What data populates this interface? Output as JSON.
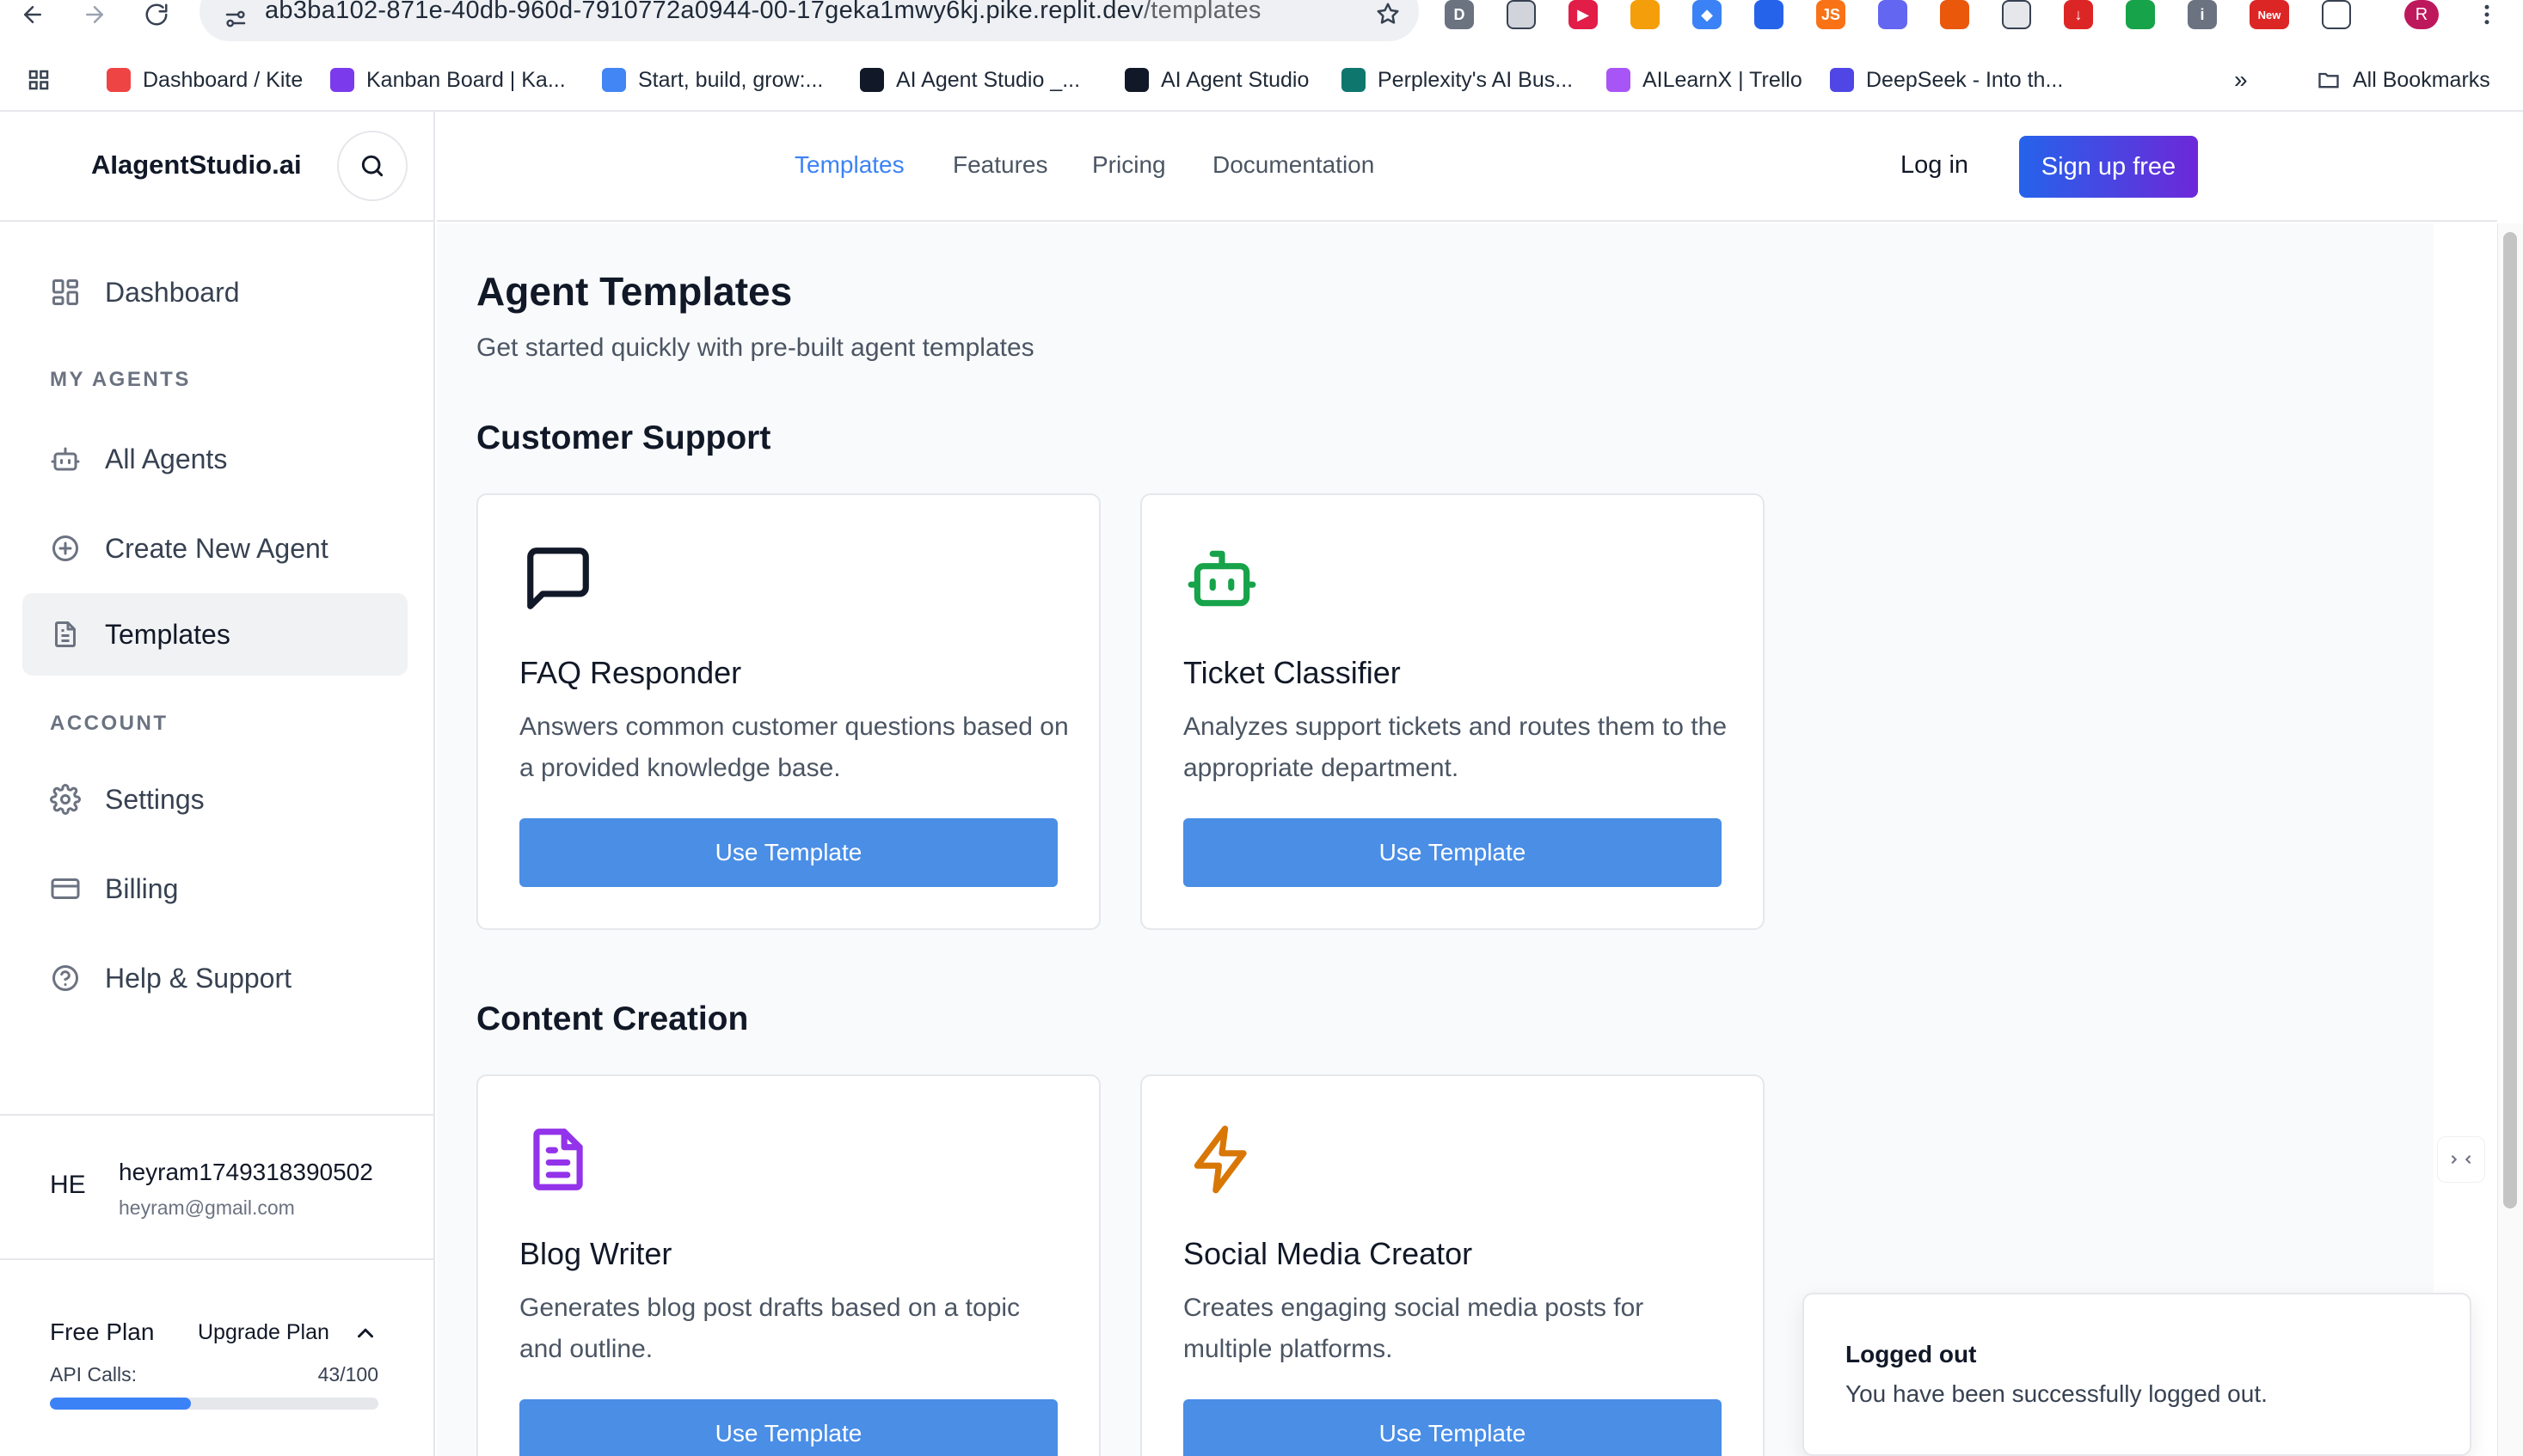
{
  "browser": {
    "url_main": "ab3ba102-871e-40db-960d-7910772a0944-00-17geka1mwy6kj.pike.replit.dev",
    "url_path": "/templates",
    "profile_initial": "R",
    "extensions": [
      {
        "icon": "d-extension-icon",
        "label": "D",
        "color": "#6b7280"
      },
      {
        "icon": "reader-extension-icon",
        "label": "",
        "color": "#d1d5db"
      },
      {
        "icon": "play-extension-icon",
        "label": "▶",
        "color": "#e11d48"
      },
      {
        "icon": "lens-extension-icon",
        "label": "",
        "color": "#f59e0b"
      },
      {
        "icon": "diamond-extension-icon",
        "label": "◆",
        "color": "#3b82f6"
      },
      {
        "icon": "tag-extension-icon",
        "label": "",
        "color": "#2563eb"
      },
      {
        "icon": "js-extension-icon",
        "label": "JS",
        "color": "#f97316"
      },
      {
        "icon": "blocks-extension-icon",
        "label": "",
        "color": "#6366f1"
      },
      {
        "icon": "fox-extension-icon",
        "label": "",
        "color": "#ea580c"
      },
      {
        "icon": "code-extension-icon",
        "label": "",
        "color": "#e5e7eb"
      },
      {
        "icon": "arrow-extension-icon",
        "label": "↓",
        "color": "#dc2626"
      },
      {
        "icon": "leaf-extension-icon",
        "label": "",
        "color": "#16a34a"
      },
      {
        "icon": "info-extension-icon",
        "label": "i",
        "color": "#6b7280"
      },
      {
        "icon": "new-extension-icon",
        "label": "New",
        "color": "#dc2626"
      },
      {
        "icon": "puzzle-extension-icon",
        "label": "",
        "color": "#ffffff"
      }
    ]
  },
  "bookmarks": {
    "items": [
      {
        "label": "Dashboard / Kite",
        "icon": "kite-icon",
        "color": "#ef4444"
      },
      {
        "label": "Kanban Board | Ka...",
        "icon": "clickup-icon",
        "color": "#7c3aed"
      },
      {
        "label": "Start, build, grow:...",
        "icon": "google-icon",
        "color": "#4285f4"
      },
      {
        "label": "AI Agent Studio _...",
        "icon": "openai-icon",
        "color": "#111827"
      },
      {
        "label": "AI Agent Studio",
        "icon": "notion-icon",
        "color": "#111827"
      },
      {
        "label": "Perplexity's AI Bus...",
        "icon": "perplexity-icon",
        "color": "#0f766e"
      },
      {
        "label": "AILearnX | Trello",
        "icon": "trello-icon",
        "color": "#a855f7"
      },
      {
        "label": "DeepSeek - Into th...",
        "icon": "deepseek-icon",
        "color": "#4f46e5"
      }
    ],
    "overflow": "»",
    "all_bookmarks": "All Bookmarks"
  },
  "sidebar": {
    "brand": "AIagentStudio.ai",
    "dashboard": "Dashboard",
    "section_agents": "MY AGENTS",
    "all_agents": "All Agents",
    "create_agent": "Create New Agent",
    "templates": "Templates",
    "section_account": "ACCOUNT",
    "settings": "Settings",
    "billing": "Billing",
    "help": "Help & Support",
    "user": {
      "initials": "HE",
      "name": "heyram1749318390502",
      "email": "heyram@gmail.com"
    },
    "plan": {
      "name": "Free Plan",
      "upgrade": "Upgrade Plan",
      "api_label": "API Calls:",
      "api_used": 43,
      "api_limit": 100,
      "api_text": "43/100"
    }
  },
  "topnav": {
    "templates": "Templates",
    "features": "Features",
    "pricing": "Pricing",
    "documentation": "Documentation",
    "login": "Log in",
    "signup": "Sign up free"
  },
  "main": {
    "title": "Agent Templates",
    "subtitle": "Get started quickly with pre-built agent templates",
    "sections": [
      {
        "title": "Customer Support",
        "cards": [
          {
            "icon": "message-square-icon",
            "icon_color": "#111827",
            "title": "FAQ Responder",
            "desc": "Answers common customer questions based on a provided knowledge base.",
            "button": "Use Template"
          },
          {
            "icon": "bot-icon",
            "icon_color": "#16a34a",
            "title": "Ticket Classifier",
            "desc": "Analyzes support tickets and routes them to the appropriate department.",
            "button": "Use Template"
          }
        ]
      },
      {
        "title": "Content Creation",
        "cards": [
          {
            "icon": "file-text-icon",
            "icon_color": "#9333ea",
            "title": "Blog Writer",
            "desc": "Generates blog post drafts based on a topic and outline.",
            "button": "Use Template"
          },
          {
            "icon": "zap-icon",
            "icon_color": "#d97706",
            "title": "Social Media Creator",
            "desc": "Creates engaging social media posts for multiple platforms.",
            "button": "Use Template"
          }
        ]
      }
    ]
  },
  "toast": {
    "title": "Logged out",
    "message": "You have been successfully logged out."
  },
  "colors": {
    "accent": "#3b82f6",
    "button": "#4a8ee6",
    "signup_gradient_start": "#2563eb",
    "signup_gradient_end": "#6d28d9"
  }
}
